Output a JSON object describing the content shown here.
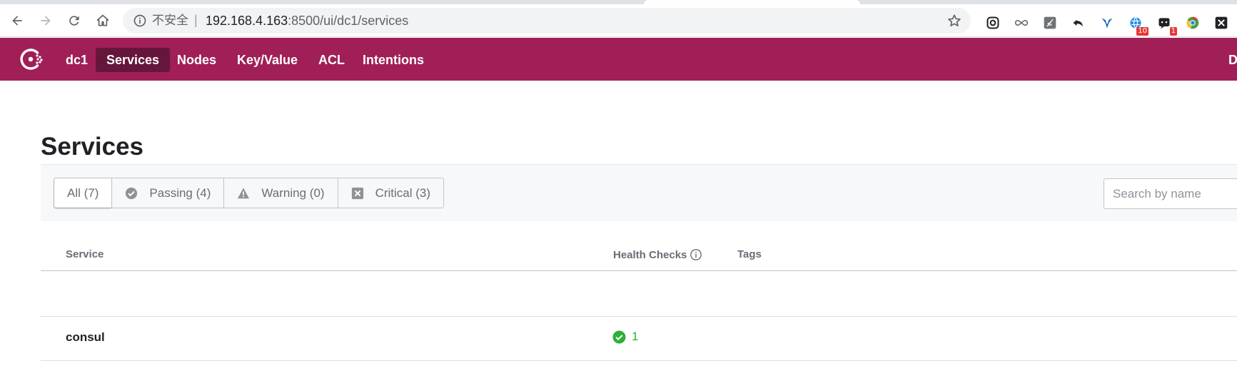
{
  "browser": {
    "security_label": "不安全",
    "separator": "|",
    "url_host": "192.168.4.163",
    "url_rest": ":8500/ui/dc1/services",
    "extensions": [
      {
        "name": "camera-ext-icon"
      },
      {
        "name": "infinity-ext-icon"
      },
      {
        "name": "feather-ext-icon"
      },
      {
        "name": "undo-ext-icon"
      },
      {
        "name": "bird-ext-icon"
      },
      {
        "name": "globe-ext-icon",
        "badge": "10"
      },
      {
        "name": "chat-ext-icon",
        "badge": "1"
      },
      {
        "name": "chrome-ext-icon"
      },
      {
        "name": "x-ext-icon"
      }
    ]
  },
  "header": {
    "datacenter": "dc1",
    "nav": [
      "Services",
      "Nodes",
      "Key/Value",
      "ACL",
      "Intentions"
    ],
    "active": "Services",
    "right_label": "D",
    "brand_color": "#a01f56"
  },
  "page": {
    "title": "Services",
    "filters": {
      "all": "All (7)",
      "passing": "Passing (4)",
      "warning": "Warning (0)",
      "critical": "Critical (3)"
    },
    "search_placeholder": "Search by name",
    "columns": {
      "service": "Service",
      "health_checks": "Health Checks",
      "tags": "Tags"
    },
    "rows": [
      {
        "service": "consul",
        "health_passing": "1",
        "tags": ""
      }
    ],
    "passing_color": "#2eb039"
  }
}
